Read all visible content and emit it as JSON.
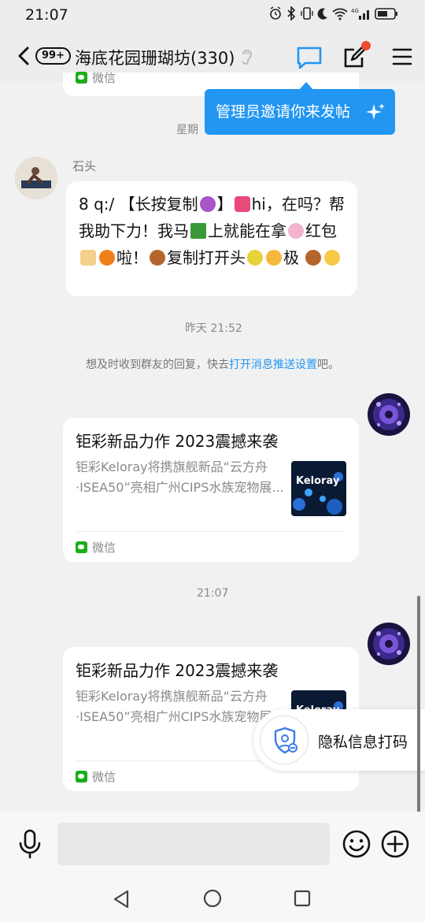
{
  "status_bar": {
    "time": "21:07",
    "icons": [
      "alarm-icon",
      "bluetooth-icon",
      "vibrate-icon",
      "moon-icon",
      "wifi-icon",
      "signal-4g-icon",
      "battery-icon"
    ]
  },
  "header": {
    "unread_badge": "99+",
    "group_title": "海底花园珊瑚坊(330)",
    "icons": [
      "back-arrow-icon",
      "ear-icon",
      "message-icon",
      "edit-icon",
      "menu-icon"
    ]
  },
  "tooltip": {
    "text": "管理员邀请你来发帖"
  },
  "chat": {
    "top_card_source": "微信",
    "time_labels": {
      "weekday": "星期",
      "yesterday": "昨天 21:52",
      "today": "21:07"
    },
    "message_1": {
      "sender": "石头",
      "parts": [
        "8 q:/ 【长按复制",
        "】",
        "hi，在吗？帮我助下力！我马",
        "上就能在拿",
        "红包",
        "",
        "啦！",
        "复制打开头",
        "",
        "极 ",
        ""
      ]
    },
    "notice": {
      "prefix": "想及时收到群友的回复，快去",
      "link": "打开消息推送设置",
      "suffix": "吧。"
    },
    "article_cards": [
      {
        "title": "钜彩新品力作 2023震撼来袭",
        "description": "钜彩Keloray将携旗舰新品“云方舟·ISEA50”亮相广州CIPS水族宠物展...",
        "thumbnail_text": "Keloray",
        "source": "微信"
      },
      {
        "title": "钜彩新品力作 2023震撼来袭",
        "description": "钜彩Keloray将携旗舰新品“云方舟·ISEA50”亮相广州CIPS水族宠物展...",
        "thumbnail_text": "Keloray",
        "source": "微信"
      }
    ]
  },
  "privacy_button": {
    "label": "隐私信息打码"
  },
  "input_bar": {
    "icons": [
      "microphone-icon",
      "emoji-icon",
      "add-icon"
    ]
  },
  "nav_bar": {
    "icons": [
      "nav-back-icon",
      "nav-home-icon",
      "nav-recents-icon"
    ]
  },
  "colors": {
    "accent": "#2196f3",
    "background": "#f1f1f1",
    "bubble": "#ffffff",
    "notification_dot": "#f04a32",
    "wechat_green": "#1aad19"
  }
}
